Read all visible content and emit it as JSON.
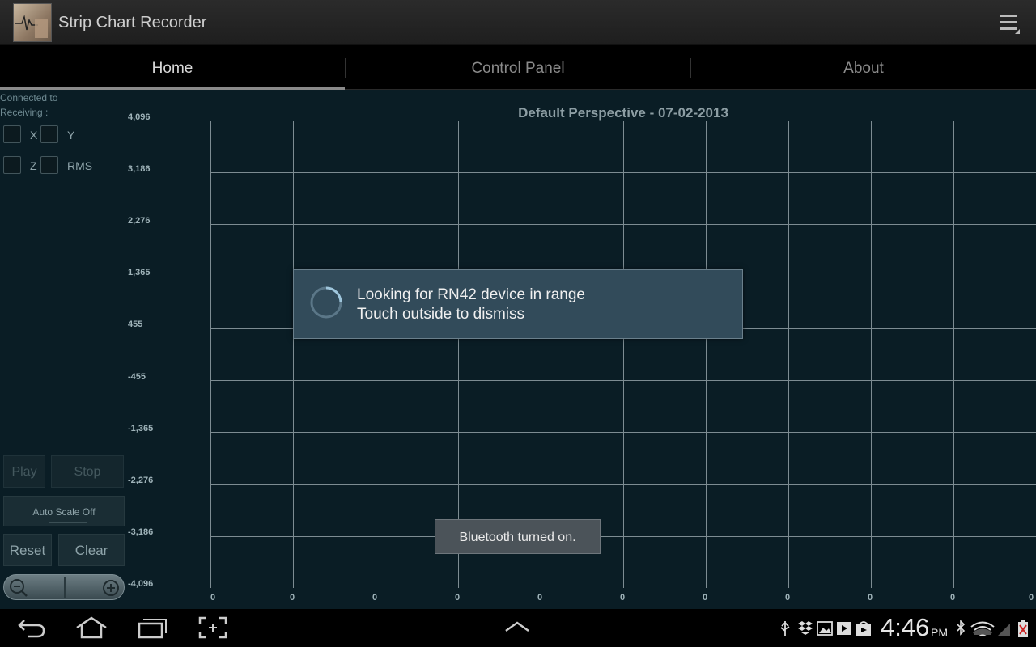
{
  "app": {
    "title": "Strip Chart Recorder"
  },
  "tabs": [
    {
      "label": "Home",
      "active": true
    },
    {
      "label": "Control Panel",
      "active": false
    },
    {
      "label": "About",
      "active": false
    }
  ],
  "sidebar": {
    "connected_label": "Connected to",
    "receiving_label": "Receiving :",
    "checkboxes": [
      {
        "label": "X",
        "checked": false
      },
      {
        "label": "Y",
        "checked": false
      },
      {
        "label": "Z",
        "checked": false
      },
      {
        "label": "RMS",
        "checked": false
      }
    ],
    "buttons": {
      "play": "Play",
      "stop": "Stop",
      "auto_scale": "Auto Scale Off",
      "reset": "Reset",
      "clear": "Clear"
    }
  },
  "chart_data": {
    "type": "line",
    "title": "Default Perspective - 07-02-2013",
    "y_ticks": [
      "4,096",
      "3,186",
      "2,276",
      "1,365",
      "455",
      "-455",
      "-1,365",
      "-2,276",
      "-3,186",
      "-4,096"
    ],
    "ylim": [
      -4096,
      4096
    ],
    "x_ticks": [
      "0",
      "0",
      "0",
      "0",
      "0",
      "0",
      "0",
      "0",
      "0",
      "0",
      "0"
    ],
    "series": [],
    "grid": true
  },
  "dialog": {
    "line1": "Looking for RN42 device in range",
    "line2": "Touch outside to dismiss"
  },
  "toast": {
    "text": "Bluetooth turned on."
  },
  "status_bar": {
    "time": "4:46",
    "ampm": "PM"
  },
  "colors": {
    "chart_background": "#0a1d25",
    "grid_line": "#7d8c92",
    "dialog_background": "#324b5a"
  }
}
